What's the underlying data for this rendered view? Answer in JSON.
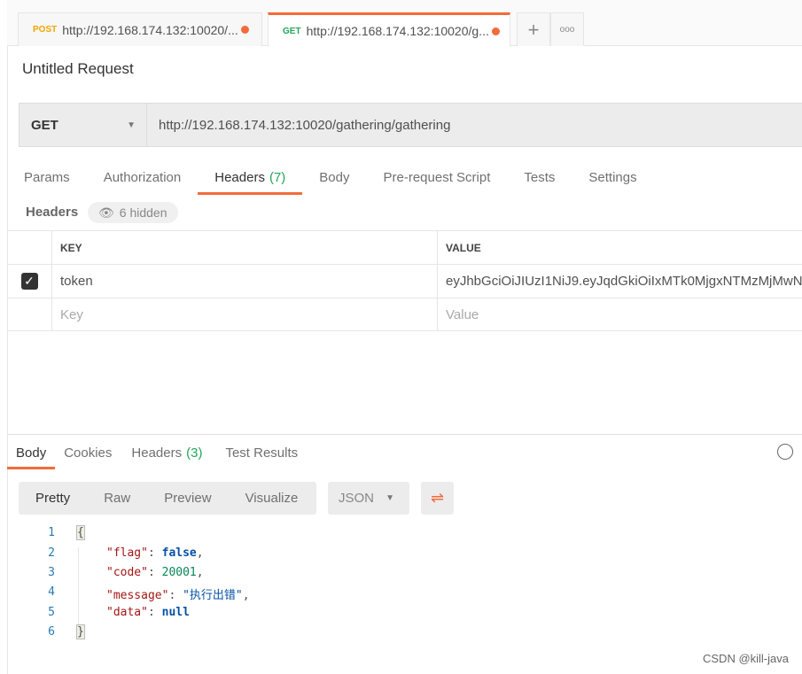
{
  "tabs": [
    {
      "method": "POST",
      "method_color": "#f0a500",
      "url": "http://192.168.174.132:10020/..."
    },
    {
      "method": "GET",
      "method_color": "#26a55a",
      "url": "http://192.168.174.132:10020/g..."
    }
  ],
  "tab_actions": {
    "new": "+",
    "more": "ooo"
  },
  "request": {
    "title": "Untitled Request",
    "method": "GET",
    "url": "http://192.168.174.132:10020/gathering/gathering"
  },
  "request_tabs": [
    {
      "label": "Params"
    },
    {
      "label": "Authorization"
    },
    {
      "label": "Headers",
      "count": "(7)"
    },
    {
      "label": "Body"
    },
    {
      "label": "Pre-request Script"
    },
    {
      "label": "Tests"
    },
    {
      "label": "Settings"
    }
  ],
  "headers": {
    "label": "Headers",
    "hidden": "6 hidden",
    "columns": [
      "KEY",
      "VALUE"
    ],
    "rows": [
      {
        "checked": true,
        "key": "token",
        "value": "eyJhbGciOiJIUzI1NiJ9.eyJqdGkiOiIxMTk0MjgxNTMzMjMwN..."
      }
    ],
    "placeholder": {
      "key": "Key",
      "value": "Value"
    }
  },
  "response_tabs": [
    {
      "label": "Body"
    },
    {
      "label": "Cookies"
    },
    {
      "label": "Headers",
      "count": "(3)"
    },
    {
      "label": "Test Results"
    }
  ],
  "view_modes": [
    "Pretty",
    "Raw",
    "Preview",
    "Visualize"
  ],
  "format": "JSON",
  "code": {
    "line_numbers": [
      "1",
      "2",
      "3",
      "4",
      "5",
      "6"
    ],
    "open": "{",
    "close": "}",
    "pairs": [
      {
        "key": "\"flag\"",
        "value": "false",
        "type": "b",
        "comma": ","
      },
      {
        "key": "\"code\"",
        "value": "20001",
        "type": "n",
        "comma": ","
      },
      {
        "key": "\"message\"",
        "value": "\"执行出错\"",
        "type": "s",
        "comma": ","
      },
      {
        "key": "\"data\"",
        "value": "null",
        "type": "b",
        "comma": ""
      }
    ]
  },
  "watermark": "CSDN @kill-java",
  "colors": {
    "accent": "#f26b3a",
    "green": "#26a55a"
  }
}
